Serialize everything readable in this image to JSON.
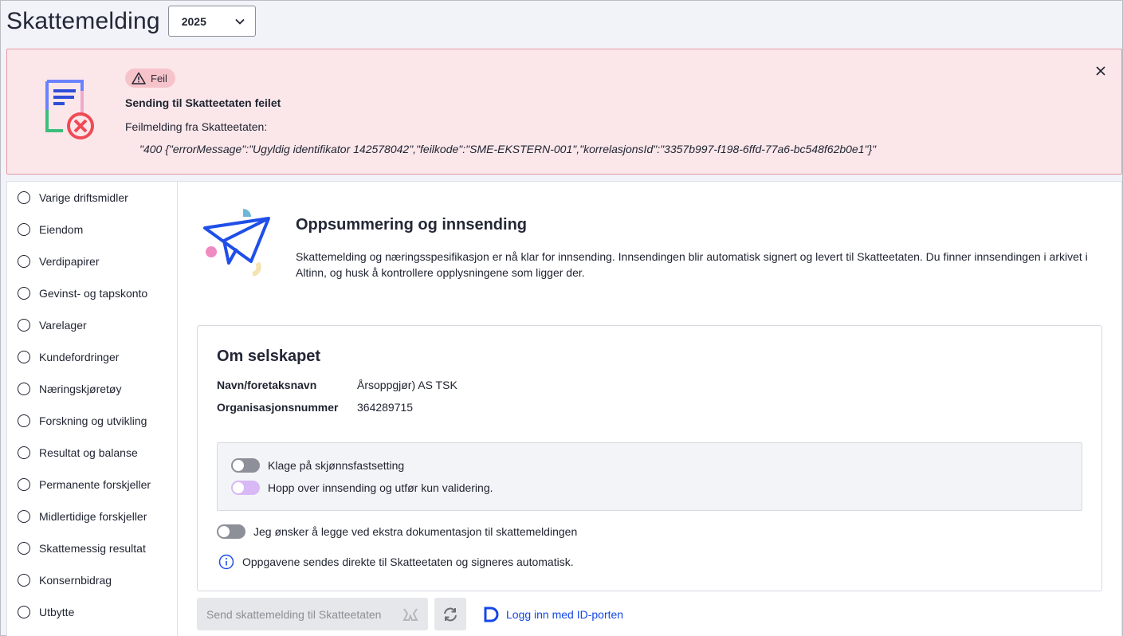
{
  "header": {
    "title": "Skattemelding",
    "year": "2025"
  },
  "alert": {
    "badge": "Feil",
    "title": "Sending til Skatteetaten feilet",
    "subtitle": "Feilmelding fra Skatteetaten:",
    "code": "\"400 {\"errorMessage\":\"Ugyldig identifikator 142578042\",\"feilkode\":\"SME-EKSTERN-001\",\"korrelasjonsId\":\"3357b997-f198-6ffd-77a6-bc548f62b0e1\"}\""
  },
  "sidebar": {
    "items": [
      {
        "label": "Varige driftsmidler"
      },
      {
        "label": "Eiendom"
      },
      {
        "label": "Verdipapirer"
      },
      {
        "label": "Gevinst- og tapskonto"
      },
      {
        "label": "Varelager"
      },
      {
        "label": "Kundefordringer"
      },
      {
        "label": "Næringskjøretøy"
      },
      {
        "label": "Forskning og utvikling"
      },
      {
        "label": "Resultat og balanse"
      },
      {
        "label": "Permanente forskjeller"
      },
      {
        "label": "Midlertidige forskjeller"
      },
      {
        "label": "Skattemessig resultat"
      },
      {
        "label": "Konsernbidrag"
      },
      {
        "label": "Utbytte"
      }
    ]
  },
  "main": {
    "title": "Oppsummering og innsending",
    "description": "Skattemelding og næringsspesifikasjon er nå klar for innsending. Innsendingen blir automatisk signert og levert til Skatteetaten. Du finner innsendingen i arkivet i Altinn, og husk å kontrollere opplysningene som ligger der.",
    "company": {
      "title": "Om selskapet",
      "name_label": "Navn/foretaksnavn",
      "name_value": "Årsoppgjør) AS TSK",
      "org_label": "Organisasjonsnummer",
      "org_value": "364289715"
    },
    "toggles": {
      "complaint": "Klage på skjønnsfastsetting",
      "skip": "Hopp over innsending og utfør kun validering.",
      "extra_docs": "Jeg ønsker å legge ved ekstra dokumentasjon til skattemeldingen"
    },
    "note": "Oppgavene sendes direkte til Skatteetaten og signeres automatisk.",
    "send_button": "Send skattemelding til Skatteetaten",
    "login_link": "Logg inn med ID-porten"
  },
  "colors": {
    "error_bg": "#fbe7ea",
    "link": "#1447e6",
    "accent_purple": "#d8b8f5"
  }
}
